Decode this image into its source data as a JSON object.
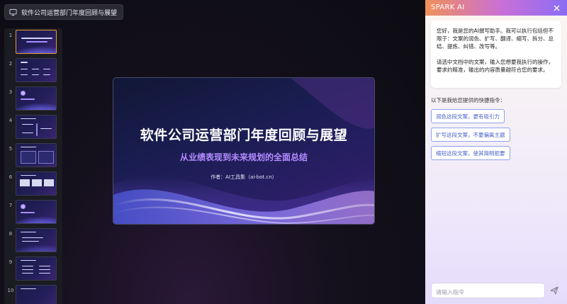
{
  "document": {
    "title": "软件公司运营部门年度回顾与展望",
    "icon": "monitor-icon"
  },
  "thumbnails": [
    {
      "num": "1",
      "active": true
    },
    {
      "num": "2"
    },
    {
      "num": "3"
    },
    {
      "num": "4"
    },
    {
      "num": "5"
    },
    {
      "num": "6"
    },
    {
      "num": "7"
    },
    {
      "num": "8"
    },
    {
      "num": "9"
    },
    {
      "num": "10"
    }
  ],
  "slide": {
    "title": "软件公司运营部门年度回顾与展望",
    "subtitle": "从业绩表现到未来规划的全面总结",
    "author": "作者：AI工具集（ai-bot.cn）"
  },
  "ai_panel": {
    "title": "SPARK AI",
    "close_icon": "close-icon",
    "message_p1": "您好，我是您的AI撰写助手。我可以执行包括但不限于：文案的润色、扩写、翻译、缩写、拆分、总结、提炼、纠错、改写等。",
    "message_p2": "请选中文档中的文案，输入您想要我执行的操作，要求约精准，输出的内容质量越符合您的要求。",
    "shortcuts_label": "以下是我给您提供的快捷指令：",
    "commands": [
      "润色这段文案，更有吸引力",
      "扩写这段文案，不要偏离主题",
      "缩短这段文案，使其简明扼要"
    ],
    "input_placeholder": "请输入指令",
    "send_icon": "send-icon"
  },
  "colors": {
    "accent_header_start": "#f0905a",
    "accent_header_end": "#8a6df5",
    "command_border": "#8fa3ea",
    "active_thumb_border": "#e79a3a",
    "subtitle_purple": "#b58cff"
  }
}
